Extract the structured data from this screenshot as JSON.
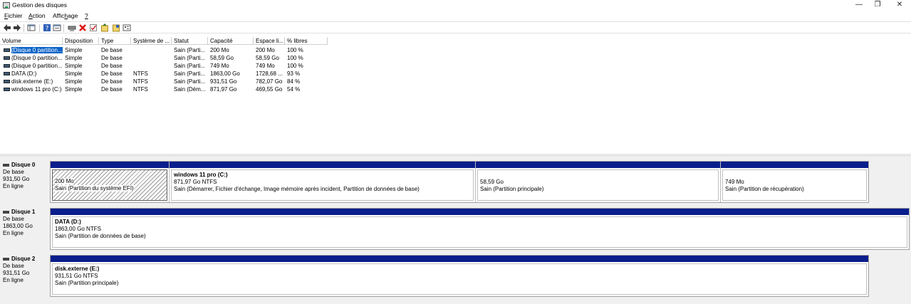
{
  "window": {
    "title": "Gestion des disques",
    "controls": {
      "minimize": "—",
      "maximize": "❐",
      "close": "✕"
    }
  },
  "menu": [
    {
      "mnemonic": "F",
      "rest": "ichier"
    },
    {
      "mnemonic": "A",
      "rest": "ction"
    },
    {
      "pre": "Affic",
      "mnemonic": "h",
      "rest": "age"
    },
    {
      "mnemonic": "?",
      "rest": ""
    }
  ],
  "toolbar": {
    "icons": [
      "back-arrow-icon",
      "forward-arrow-icon",
      "console-tree-icon",
      "help-icon",
      "properties-icon",
      "connect-drive-icon",
      "delete-icon",
      "check-icon",
      "import-disk-icon",
      "new-volume-icon",
      "settings-icon"
    ]
  },
  "table": {
    "columns": [
      "Volume",
      "Disposition",
      "Type",
      "Système de ...",
      "Statut",
      "Capacité",
      "Espace li...",
      "% libres"
    ],
    "rows": [
      [
        "(Disque 0 partition...",
        "Simple",
        "De base",
        "",
        "Sain (Parti...",
        "200 Mo",
        "200 Mo",
        "100 %"
      ],
      [
        "(Disque 0 partition...",
        "Simple",
        "De base",
        "",
        "Sain (Parti...",
        "58,59 Go",
        "58,59 Go",
        "100 %"
      ],
      [
        "(Disque 0 partition...",
        "Simple",
        "De base",
        "",
        "Sain (Parti...",
        "749 Mo",
        "749 Mo",
        "100 %"
      ],
      [
        "DATA (D:)",
        "Simple",
        "De base",
        "NTFS",
        "Sain (Parti...",
        "1863,00 Go",
        "1728,68 ...",
        "93 %"
      ],
      [
        "disk.externe (E:)",
        "Simple",
        "De base",
        "NTFS",
        "Sain (Parti...",
        "931,51 Go",
        "782,07 Go",
        "84 %"
      ],
      [
        "windows 11 pro (C:)",
        "Simple",
        "De base",
        "NTFS",
        "Sain (Dém...",
        "871,97 Go",
        "469,55 Go",
        "54 %"
      ]
    ]
  },
  "disks": [
    {
      "name": "Disque 0",
      "type": "De base",
      "size": "931,50 Go",
      "state": "En ligne",
      "partitions": [
        {
          "title": "",
          "size": "200 Mo",
          "status": "Sain (Partition du système EFI)"
        },
        {
          "title": "windows 11 pro  (C:)",
          "size": "871,97 Go NTFS",
          "status": "Sain (Démarrer, Fichier d'échange, Image mémoire après incident, Partition de données de base)"
        },
        {
          "title": "",
          "size": "58,59 Go",
          "status": "Sain (Partition principale)"
        },
        {
          "title": "",
          "size": "749 Mo",
          "status": "Sain (Partition de récupération)"
        }
      ]
    },
    {
      "name": "Disque 1",
      "type": "De base",
      "size": "1863,00 Go",
      "state": "En ligne",
      "partitions": [
        {
          "title": "DATA  (D:)",
          "size": "1863,00 Go NTFS",
          "status": "Sain (Partition de données de base)"
        }
      ]
    },
    {
      "name": "Disque 2",
      "type": "De base",
      "size": "931,51 Go",
      "state": "En ligne",
      "partitions": [
        {
          "title": "disk.externe  (E:)",
          "size": "931,51 Go NTFS",
          "status": "Sain (Partition principale)"
        }
      ]
    }
  ]
}
